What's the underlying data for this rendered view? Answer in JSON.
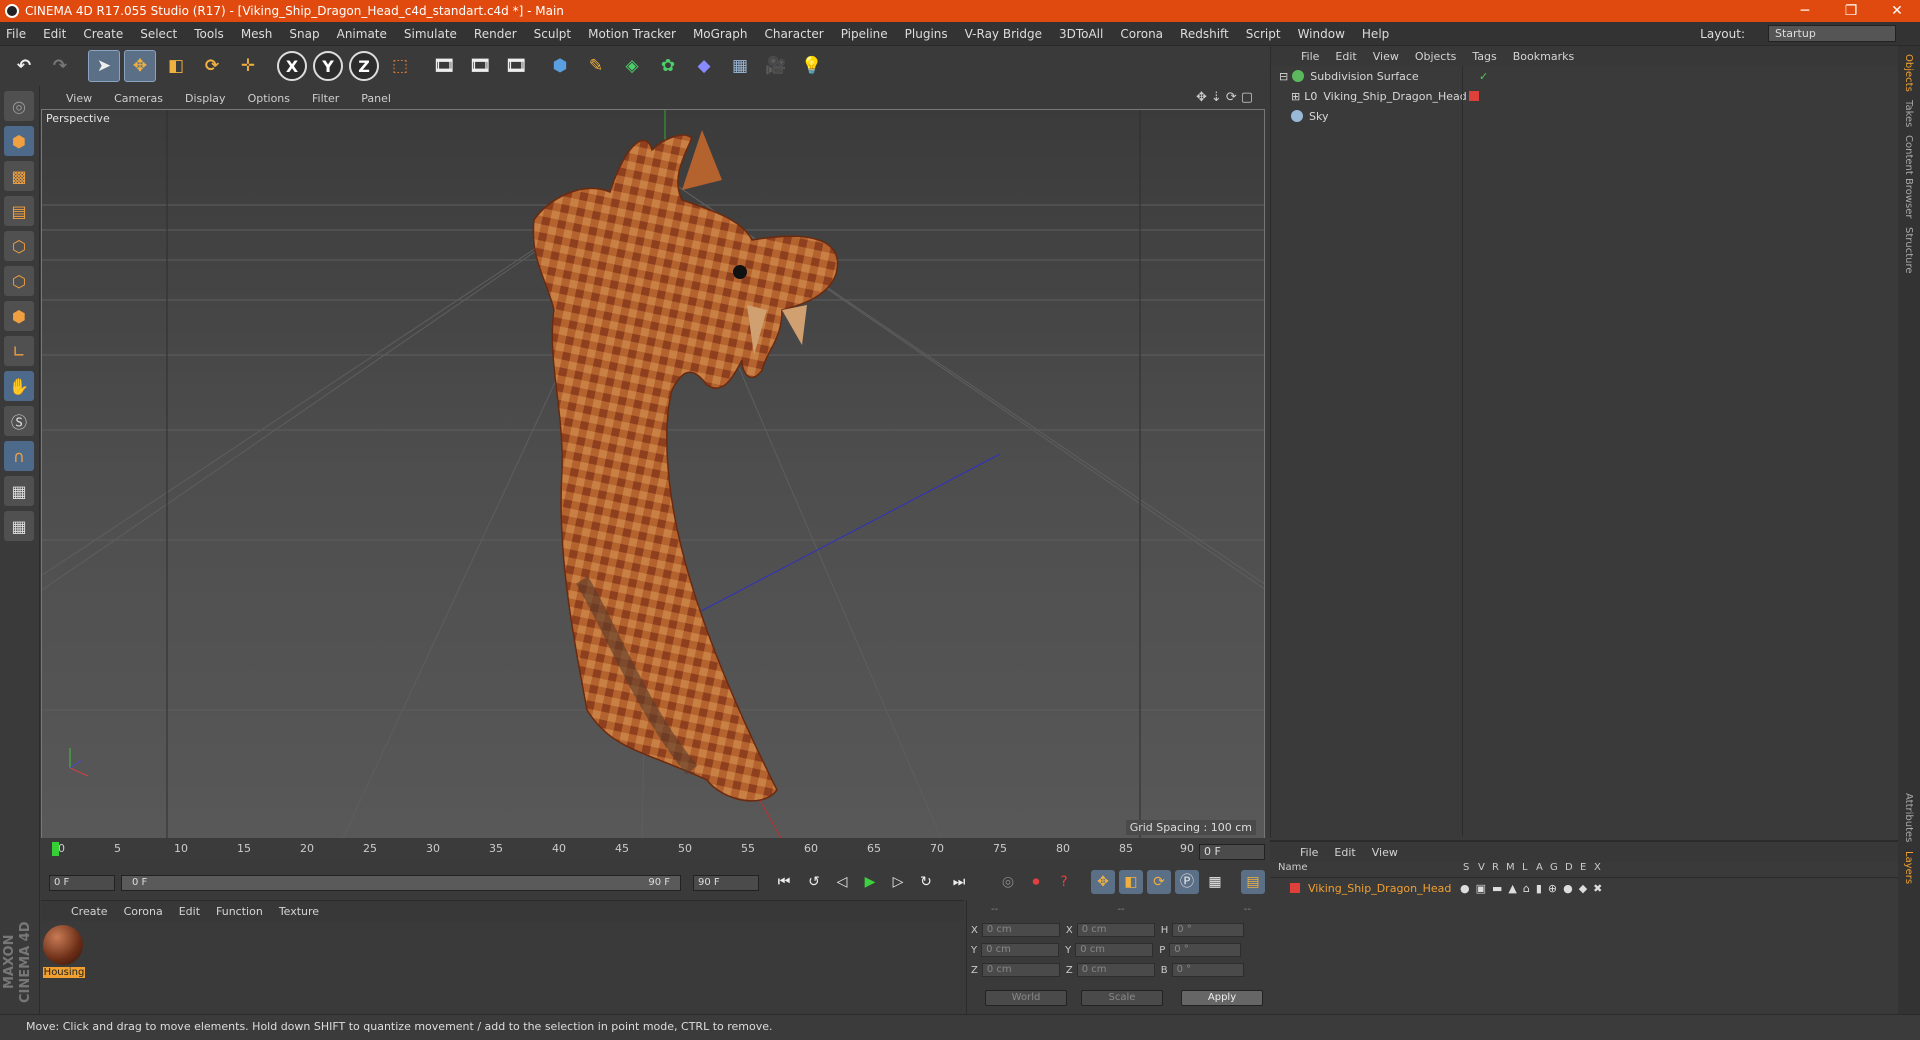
{
  "titlebar": {
    "title": "CINEMA 4D R17.055 Studio (R17) - [Viking_Ship_Dragon_Head_c4d_standart.c4d *] - Main",
    "minimize": "─",
    "restore": "❐",
    "close": "✕"
  },
  "menubar": {
    "items": [
      "File",
      "Edit",
      "Create",
      "Select",
      "Tools",
      "Mesh",
      "Snap",
      "Animate",
      "Simulate",
      "Render",
      "Sculpt",
      "Motion Tracker",
      "MoGraph",
      "Character",
      "Pipeline",
      "Plugins",
      "V-Ray Bridge",
      "3DToAll",
      "Corona",
      "Redshift",
      "Script",
      "Window",
      "Help"
    ],
    "layout_label": "Layout:",
    "layout_value": "Startup"
  },
  "toolbar": {
    "axis_x": "X",
    "axis_y": "Y",
    "axis_z": "Z"
  },
  "viewport": {
    "menu": [
      "View",
      "Cameras",
      "Display",
      "Options",
      "Filter",
      "Panel"
    ],
    "label": "Perspective",
    "grid_spacing": "Grid Spacing : 100 cm"
  },
  "object_manager": {
    "menu": [
      "File",
      "Edit",
      "View",
      "Objects",
      "Tags",
      "Bookmarks"
    ],
    "objects": [
      {
        "name": "Subdivision Surface",
        "icon": "subdivision-icon",
        "color": "#5cb85c"
      },
      {
        "name": "Viking_Ship_Dragon_Head",
        "icon": "null-icon",
        "color": "#d0d0d0"
      },
      {
        "name": "Sky",
        "icon": "sky-icon",
        "color": "#9ab8d8"
      }
    ]
  },
  "side_tabs": [
    "Objects",
    "Takes",
    "Content Browser",
    "Structure",
    "Attributes",
    "Layers"
  ],
  "timeline": {
    "ticks": [
      "0",
      "5",
      "10",
      "15",
      "20",
      "25",
      "30",
      "35",
      "40",
      "45",
      "50",
      "55",
      "60",
      "65",
      "70",
      "75",
      "80",
      "85",
      "90"
    ],
    "current_frame": "0 F",
    "start_frame": "0 F",
    "range_start": "0 F",
    "range_end": "90 F",
    "end_frame": "90 F"
  },
  "material_manager": {
    "menu": [
      "Create",
      "Corona",
      "Edit",
      "Function",
      "Texture"
    ],
    "material_name": "Housing"
  },
  "coordinates": {
    "header": [
      "--",
      "--",
      "--"
    ],
    "rows": [
      {
        "a": "X",
        "av": "0 cm",
        "b": "X",
        "bv": "0 cm",
        "c": "H",
        "cv": "0 °"
      },
      {
        "a": "Y",
        "av": "0 cm",
        "b": "Y",
        "bv": "0 cm",
        "c": "P",
        "cv": "0 °"
      },
      {
        "a": "Z",
        "av": "0 cm",
        "b": "Z",
        "bv": "0 cm",
        "c": "B",
        "cv": "0 °"
      }
    ],
    "mode": "World",
    "transform": "Scale",
    "apply": "Apply"
  },
  "layer_manager": {
    "menu": [
      "File",
      "Edit",
      "View"
    ],
    "columns": [
      "Name",
      "S",
      "V",
      "R",
      "M",
      "L",
      "A",
      "G",
      "D",
      "E",
      "X"
    ],
    "layer_name": "Viking_Ship_Dragon_Head",
    "layer_color": "#e0403a"
  },
  "status": "Move: Click and drag to move elements. Hold down SHIFT to quantize movement / add to the selection in point mode, CTRL to remove."
}
